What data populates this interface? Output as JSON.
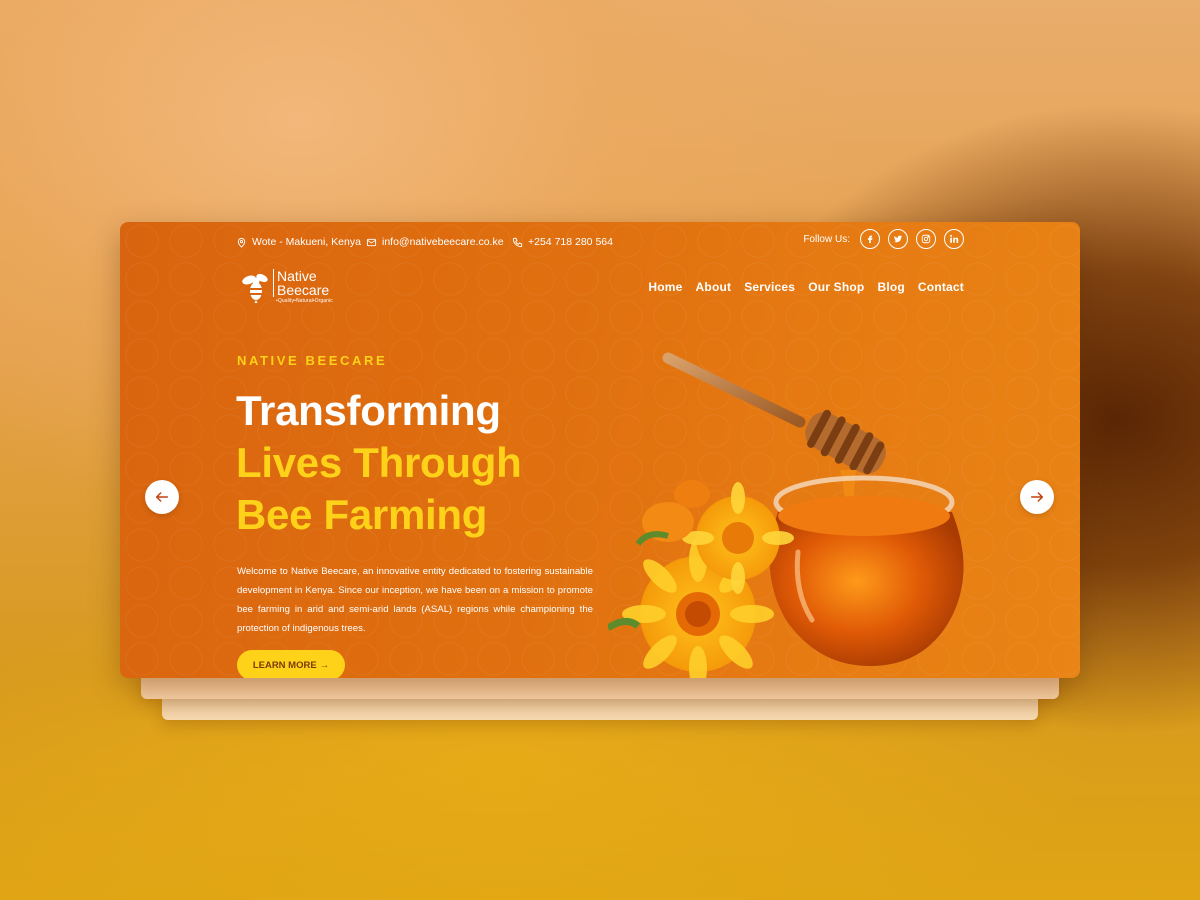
{
  "topbar": {
    "location": "Wote - Makueni, Kenya",
    "email": "info@nativebeecare.co.ke",
    "phone": "+254 718 280 564",
    "follow_label": "Follow Us:",
    "socials": [
      "facebook-icon",
      "twitter-icon",
      "instagram-icon",
      "linkedin-icon"
    ]
  },
  "logo": {
    "line1": "Native",
    "line2": "Beecare",
    "tagline": "•Quality•Natural•Organic"
  },
  "nav": {
    "items": [
      "Home",
      "About",
      "Services",
      "Our Shop",
      "Blog",
      "Contact"
    ]
  },
  "hero": {
    "eyebrow": "NATIVE BEECARE",
    "title_line1": "Transforming",
    "title_line2": "Lives Through",
    "title_line3": "Bee Farming",
    "description": "Welcome to Native Beecare, an innovative entity dedicated to fostering sustainable development in Kenya. Since our inception, we have been on a mission to promote bee farming in arid and semi-arid lands (ASAL) regions while championing the protection of indigenous trees.",
    "cta_label": "LEARN MORE",
    "cta_arrow": "→"
  },
  "colors": {
    "hero_bg": "#e0700f",
    "accent_yellow": "#ffd21a",
    "text_white": "#ffffff",
    "cta_text": "#7a3b04"
  }
}
